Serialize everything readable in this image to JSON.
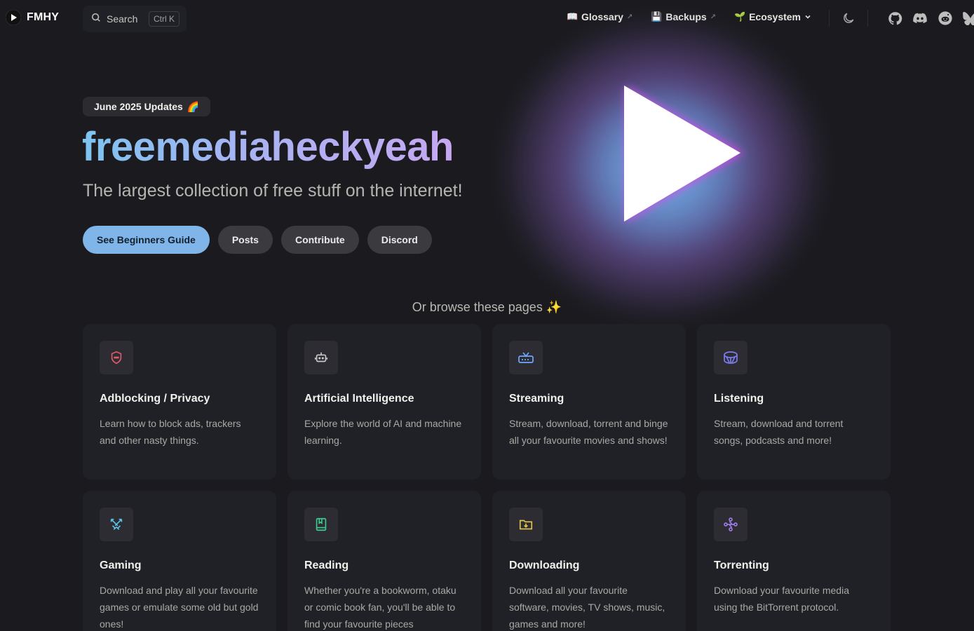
{
  "nav": {
    "brand": "FMHY",
    "search_label": "Search",
    "search_shortcut": "Ctrl K",
    "links": [
      {
        "emoji": "📖",
        "label": "Glossary",
        "external": true
      },
      {
        "emoji": "💾",
        "label": "Backups",
        "external": true
      },
      {
        "emoji": "🌱",
        "label": "Ecosystem",
        "dropdown": true
      }
    ],
    "icons": [
      "moon-icon",
      "github-icon",
      "discord-icon",
      "reddit-icon",
      "bluesky-icon"
    ]
  },
  "hero": {
    "badge": "June 2025 Updates",
    "badge_emoji": "🌈",
    "title": "freemediaheckyeah",
    "tagline": "The largest collection of free stuff on the internet!",
    "buttons": [
      "See Beginners Guide",
      "Posts",
      "Contribute",
      "Discord"
    ]
  },
  "browse": {
    "label": "Or browse these pages",
    "emoji": "✨"
  },
  "cards": [
    {
      "icon": "shield-icon",
      "color": "#e05a6a",
      "title": "Adblocking / Privacy",
      "desc": "Learn how to block ads, trackers and other nasty things."
    },
    {
      "icon": "robot-icon",
      "color": "#c8c8c8",
      "title": "Artificial Intelligence",
      "desc": "Explore the world of AI and machine learning."
    },
    {
      "icon": "tv-icon",
      "color": "#6fa8ff",
      "title": "Streaming",
      "desc": "Stream, download, torrent and binge all your favourite movies and shows!"
    },
    {
      "icon": "drum-icon",
      "color": "#7c7cf0",
      "title": "Listening",
      "desc": "Stream, download and torrent songs, podcasts and more!"
    },
    {
      "icon": "swords-icon",
      "color": "#5ec3e8",
      "title": "Gaming",
      "desc": "Download and play all your favourite games or emulate some old but gold ones!"
    },
    {
      "icon": "book-icon",
      "color": "#3ec98f",
      "title": "Reading",
      "desc": "Whether you're a bookworm, otaku or comic book fan, you'll be able to find your favourite pieces"
    },
    {
      "icon": "folder-download-icon",
      "color": "#e2c64a",
      "title": "Downloading",
      "desc": "Download all your favourite software, movies, TV shows, music, games and more!"
    },
    {
      "icon": "magnet-icon",
      "color": "#9b7be0",
      "title": "Torrenting",
      "desc": "Download your favourite media using the BitTorrent protocol."
    }
  ]
}
